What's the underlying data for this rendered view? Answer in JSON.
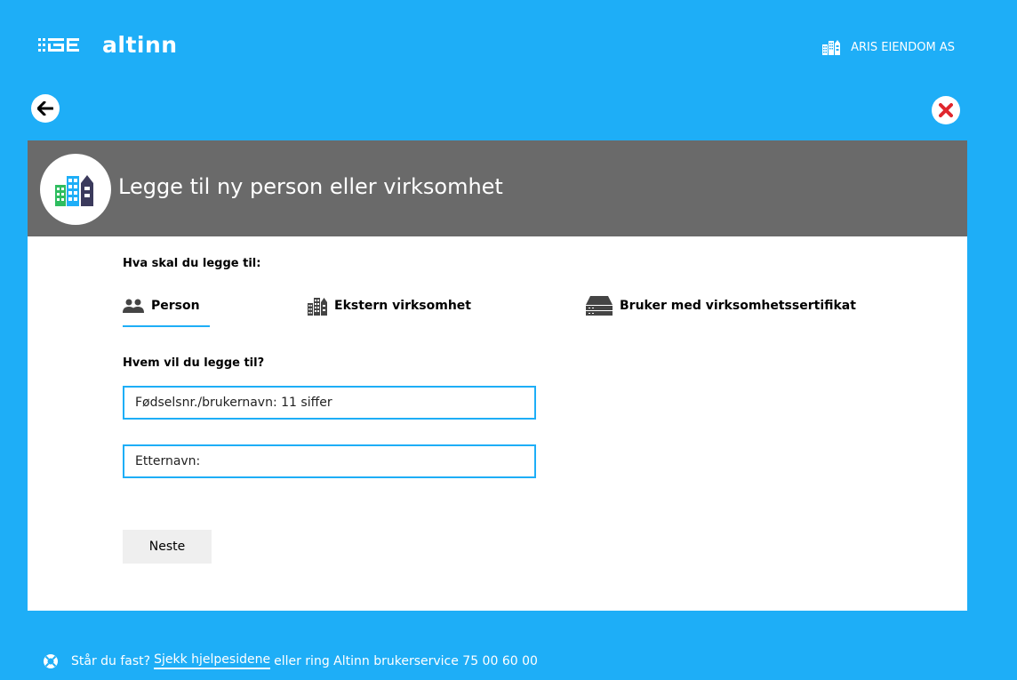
{
  "brand": {
    "name": "altinn"
  },
  "header": {
    "organization": "ARIS EIENDOM AS"
  },
  "panel": {
    "title": "Legge til ny person eller virksomhet",
    "question_type": "Hva skal du legge til:",
    "tabs": [
      {
        "label": "Person",
        "icon": "people-icon",
        "active": true
      },
      {
        "label": "Ekstern virksomhet",
        "icon": "buildings-icon",
        "active": false
      },
      {
        "label": "Bruker med virksomhetssertifikat",
        "icon": "server-icon",
        "active": false
      }
    ],
    "question_who": "Hvem vil du legge til?",
    "ssn_placeholder": "Fødselsnr./brukernavn: 11 siffer",
    "lastname_placeholder": "Etternavn:",
    "next_label": "Neste"
  },
  "footer": {
    "prefix": "Står du fast?",
    "link": "Sjekk hjelpesidene",
    "suffix": "eller ring Altinn brukerservice 75 00 60 00"
  },
  "colors": {
    "accent": "#1eaef7",
    "header_bg": "#6a6a6a",
    "button_bg": "#efefef"
  }
}
